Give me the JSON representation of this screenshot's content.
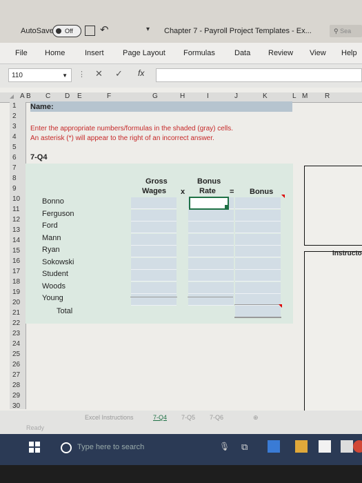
{
  "titlebar": {
    "autosave_label": "AutoSave",
    "autosave_state": "Off",
    "doc_title": "Chapter 7 - Payroll Project Templates - Ex...",
    "search_placeholder": "Sea"
  },
  "ribbon": {
    "tabs": [
      "File",
      "Home",
      "Insert",
      "Page Layout",
      "Formulas",
      "Data",
      "Review",
      "View",
      "Help"
    ]
  },
  "formula_bar": {
    "name_box": "110",
    "cancel_symbol": "✕",
    "enter_symbol": "✓",
    "fx": "fx",
    "value": ""
  },
  "columns": [
    "A",
    "B",
    "C",
    "D",
    "E",
    "F",
    "G",
    "H",
    "I",
    "J",
    "K",
    "L",
    "M",
    "R"
  ],
  "rows": [
    "1",
    "2",
    "3",
    "4",
    "5",
    "6",
    "7",
    "8",
    "9",
    "10",
    "11",
    "12",
    "13",
    "14",
    "15",
    "16",
    "17",
    "18",
    "19",
    "20",
    "21",
    "22",
    "23",
    "24",
    "25",
    "26",
    "27",
    "28",
    "29",
    "30"
  ],
  "sheet": {
    "name_label": "Name:",
    "instruction_1": "Enter the appropriate numbers/formulas in the shaded (gray) cells.",
    "instruction_2": "An asterisk (*) will appear to the right of an incorrect answer.",
    "section": "7-Q4",
    "headers": {
      "gross_1": "Gross",
      "gross_2": "Wages",
      "times": "x",
      "rate_1": "Bonus",
      "rate_2": "Rate",
      "equals": "=",
      "bonus": "Bonus"
    },
    "employees": [
      "Bonno",
      "Ferguson",
      "Ford",
      "Mann",
      "Ryan",
      "Sokowski",
      "Student",
      "Woods",
      "Young"
    ],
    "total_label": "Total",
    "side_label": "Instructo"
  },
  "sheet_tabs": [
    "Excel Instructions",
    "7-Q4",
    "7-Q5",
    "7-Q6"
  ],
  "active_sheet": "7-Q4",
  "status": "Ready",
  "taskbar": {
    "search_placeholder": "Type here to search"
  },
  "colors": {
    "accent_green": "#1e7145",
    "shaded_cell": "#d2dde5",
    "sheet_green": "#dce9e1",
    "taskbar": "#2b3a55"
  }
}
